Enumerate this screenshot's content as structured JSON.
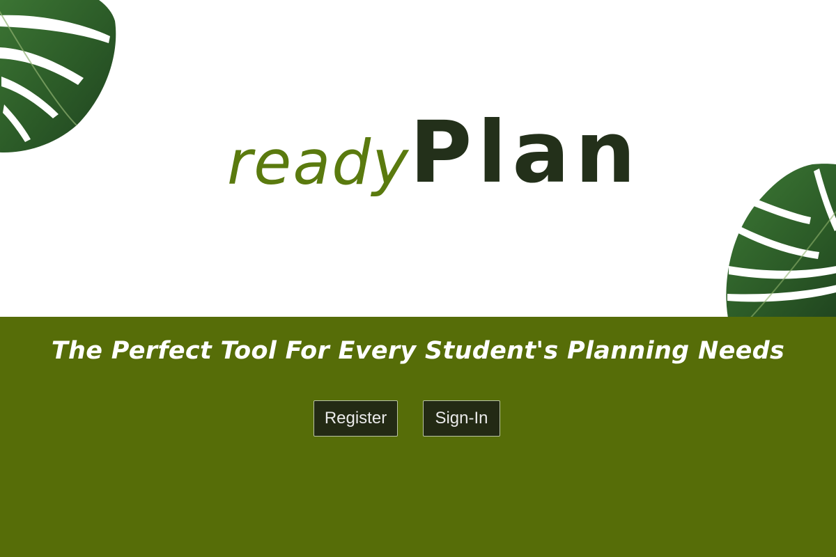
{
  "brand": {
    "logo_part1": "ready",
    "logo_part2": "Plan"
  },
  "hero": {
    "tagline": "The Perfect Tool For Every Student's Planning Needs"
  },
  "actions": {
    "register_label": "Register",
    "signin_label": "Sign-In"
  },
  "decor": {
    "icons": [
      "monstera-leaf-icon",
      "monstera-leaf-icon"
    ]
  },
  "colors": {
    "band": "#566d08",
    "ready_text": "#5a7a0e",
    "plan_text": "#23301a",
    "button_bg": "#232a14",
    "leaf": "#2e5a2a"
  }
}
